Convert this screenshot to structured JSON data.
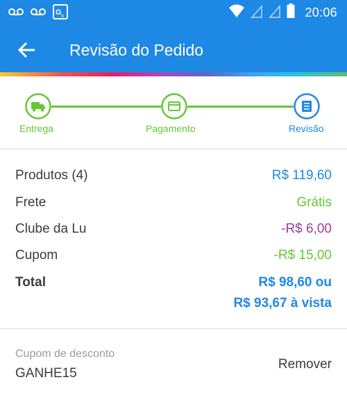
{
  "status_bar": {
    "time": "20:06",
    "icons": [
      "voicemail-icon",
      "voicemail-icon",
      "translate-icon",
      "wifi-icon",
      "signal-icon",
      "signal-icon",
      "battery-icon"
    ]
  },
  "toolbar": {
    "title": "Revisão do Pedido",
    "back_icon": "arrow-left-icon"
  },
  "stepper": {
    "steps": [
      {
        "label": "Entrega",
        "icon": "truck-icon",
        "state": "done"
      },
      {
        "label": "Pagamento",
        "icon": "card-icon",
        "state": "done"
      },
      {
        "label": "Revisão",
        "icon": "list-icon",
        "state": "current"
      }
    ]
  },
  "summary": {
    "products": {
      "label": "Produtos (4)",
      "value": "R$ 119,60"
    },
    "shipping": {
      "label": "Frete",
      "value": "Grátis"
    },
    "club": {
      "label": "Clube da Lu",
      "value": "-R$ 6,00"
    },
    "coupon": {
      "label": "Cupom",
      "value": "-R$ 15,00"
    },
    "total": {
      "label": "Total",
      "value_line1": "R$ 98,60 ou",
      "value_line2": "R$ 93,67 à vista"
    }
  },
  "coupon_section": {
    "caption": "Cupom de desconto",
    "code": "GANHE15",
    "remove_label": "Remover"
  },
  "colors": {
    "primary_blue": "#1e88e5",
    "green": "#64c832",
    "purple": "#9c3c9c",
    "text": "#3c3c3c",
    "muted": "#9a9a9a"
  }
}
